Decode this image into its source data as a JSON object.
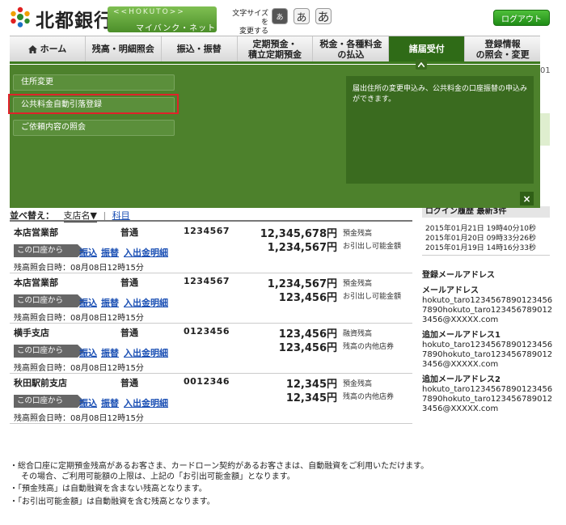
{
  "header": {
    "bank_name": "北都銀行",
    "banner_hokuto": "<<HOKUTO>>",
    "banner_sub": "マイバンク・ネット",
    "fontsize_label": "文字サイズを\n変更する",
    "fontsize_small": "あ",
    "fontsize_medium": "あ",
    "fontsize_large": "あ",
    "logout": "ログアウト"
  },
  "nav": {
    "items": [
      {
        "label": "ホーム"
      },
      {
        "label": "残高・明細照会"
      },
      {
        "label": "振込・振替"
      },
      {
        "label": "定期預金・\n積立定期預金"
      },
      {
        "label": "税金・各種料金\nの払込"
      },
      {
        "label": "諸届受付"
      },
      {
        "label": "登録情報\nの照会・変更"
      }
    ],
    "active": "諸届受付",
    "version_digits": "01"
  },
  "panel": {
    "menu": [
      "住所変更",
      "公共料金自動引落登録",
      "ご依頼内容の照会"
    ],
    "highlighted": "公共料金自動引落登録",
    "description": "届出住所の変更申込み、公共料金の口座振替の申込みができます。",
    "close": "×"
  },
  "sort": {
    "label": "並べ替え：",
    "option_branch": "支店名▼",
    "separator": "|",
    "option_subject": "科目"
  },
  "accounts": [
    {
      "branch": "本店営業部",
      "type": "普通",
      "number": "1234567",
      "bal1": "12,345,678円",
      "lab1": "預金残高",
      "bal2": "1,234,567円",
      "lab2": "お引出し可能金額",
      "from": "この口座から",
      "l1": "振込",
      "l2": "振替",
      "l3": "入出金明細",
      "inquiry": "残高照会日時：08月08日12時15分"
    },
    {
      "branch": "本店営業部",
      "type": "普通",
      "number": "1234567",
      "bal1": "1,234,567円",
      "lab1": "預金残高",
      "bal2": "123,456円",
      "lab2": "お引出し可能金額",
      "from": "この口座から",
      "l1": "振込",
      "l2": "振替",
      "l3": "入出金明細",
      "inquiry": "残高照会日時：08月08日12時15分"
    },
    {
      "branch": "横手支店",
      "type": "普通",
      "number": "0123456",
      "bal1": "123,456円",
      "lab1": "融資残高",
      "bal2": "123,456円",
      "lab2": "残高の内他店券",
      "from": "この口座から",
      "l1": "振込",
      "l2": "振替",
      "l3": "入出金明細",
      "inquiry": "残高照会日時：08月08日12時15分"
    },
    {
      "branch": "秋田駅前支店",
      "type": "普通",
      "number": "0012346",
      "bal1": "12,345円",
      "lab1": "預金残高",
      "bal2": "12,345円",
      "lab2": "残高の内他店券",
      "from": "この口座から",
      "l1": "振込",
      "l2": "振替",
      "l3": "入出金明細",
      "inquiry": "残高照会日時：08月08日12時15分"
    }
  ],
  "login_history": {
    "title": "ログイン履歴  最新3件",
    "entries": [
      "2015年01月21日 19時40分10秒",
      "2015年01月20日 09時33分26秒",
      "2015年01月19日 14時16分33秒"
    ]
  },
  "mail": {
    "heading": "登録メールアドレス",
    "entries": [
      {
        "title": "メールアドレス",
        "address": "hokuto_taro1234567890123456 7890hokuto_taro123456789012 3456@XXXXX.com"
      },
      {
        "title": "追加メールアドレス1",
        "address": "hokuto_taro1234567890123456 7890hokuto_taro123456789012 3456@XXXXX.com"
      },
      {
        "title": "追加メールアドレス2",
        "address": "hokuto_taro1234567890123456 7890hokuto_taro123456789012 3456@XXXXX.com"
      }
    ]
  },
  "notes": [
    "総合口座に定期預金残高があるお客さま、カードローン契約があるお客さまは、自動融資をご利用いただけます。\nその場合、ご利用可能額の上限は、上記の「お引出可能金額」となります。",
    "「預金残高」は自動融資を含まない残高となります。",
    "「お引出可能金額」は自動融資を含む残高となります。"
  ],
  "colors": {
    "brand_green": "#2f6b17",
    "panel_green": "#4d812c",
    "highlight_red": "#e0222a",
    "link_blue": "#1a4fb4"
  }
}
